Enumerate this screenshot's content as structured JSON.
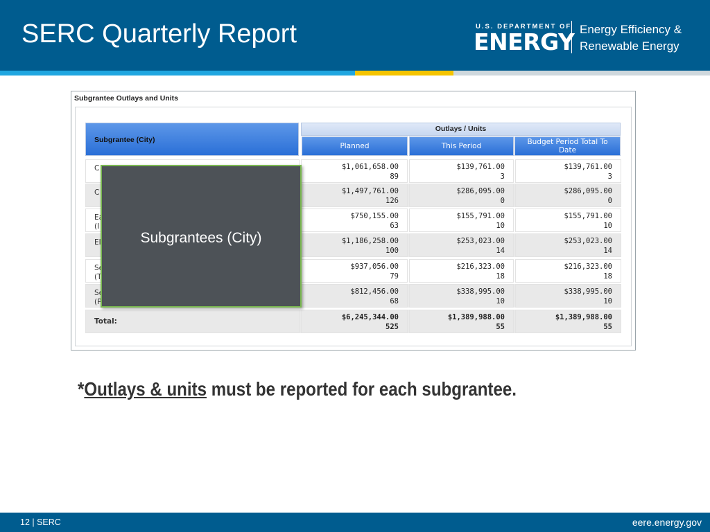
{
  "slide": {
    "title": "SERC Quarterly Report",
    "logo_small": "U.S. DEPARTMENT OF",
    "logo_big": "ENERGY",
    "office_line1": "Energy Efficiency &",
    "office_line2": "Renewable Energy"
  },
  "panel": {
    "title": "Subgrantee Outlays and Units",
    "col_subgrantee": "Subgrantee (City)",
    "col_group": "Outlays / Units",
    "col_planned": "Planned",
    "col_this_period": "This Period",
    "col_budget_line1": "Budget Period Total To",
    "col_budget_line2": "Date",
    "rows": [
      {
        "name1": "C",
        "name2": "",
        "planned": "$1,061,658.00",
        "planned_units": "89",
        "period": "$139,761.00",
        "period_units": "3",
        "budget": "$139,761.00",
        "budget_units": "3"
      },
      {
        "name1": "C",
        "name2": "",
        "planned": "$1,497,761.00",
        "planned_units": "126",
        "period": "$286,095.00",
        "period_units": "0",
        "budget": "$286,095.00",
        "budget_units": "0"
      },
      {
        "name1": "Ea",
        "name2": "(I",
        "planned": "$750,155.00",
        "planned_units": "63",
        "period": "$155,791.00",
        "period_units": "10",
        "budget": "$155,791.00",
        "budget_units": "10"
      },
      {
        "name1": "El",
        "name2": "",
        "planned": "$1,186,258.00",
        "planned_units": "100",
        "period": "$253,023.00",
        "period_units": "14",
        "budget": "$253,023.00",
        "budget_units": "14"
      },
      {
        "name1": "Se",
        "name2": "(T",
        "planned": "$937,056.00",
        "planned_units": "79",
        "period": "$216,323.00",
        "period_units": "18",
        "budget": "$216,323.00",
        "budget_units": "18"
      },
      {
        "name1": "Se",
        "name2": "(P",
        "planned": "$812,456.00",
        "planned_units": "68",
        "period": "$338,995.00",
        "period_units": "10",
        "budget": "$338,995.00",
        "budget_units": "10"
      }
    ],
    "total": {
      "name": "Total:",
      "planned": "$6,245,344.00",
      "planned_units": "525",
      "period": "$1,389,988.00",
      "period_units": "55",
      "budget": "$1,389,988.00",
      "budget_units": "55"
    }
  },
  "overlay": {
    "label": "Subgrantees (City)"
  },
  "note": {
    "prefix": "*",
    "underlined": "Outlays & units",
    "rest": " must be reported for each subgrantee."
  },
  "footer": {
    "left": "12 | SERC",
    "right": "eere.energy.gov"
  }
}
